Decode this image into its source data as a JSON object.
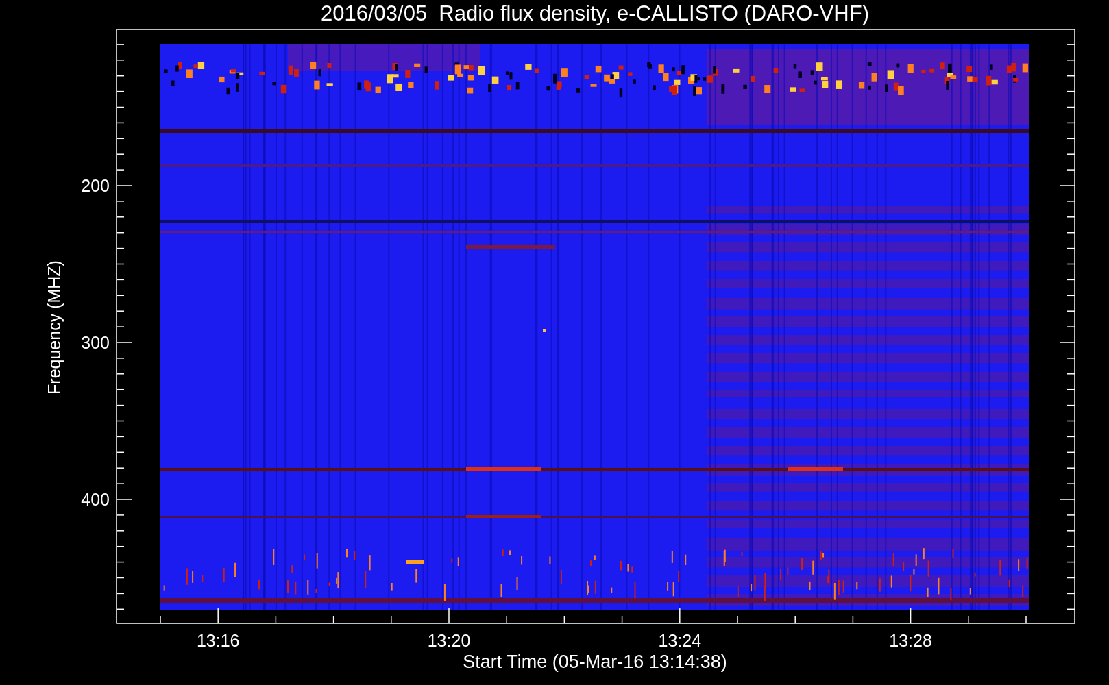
{
  "title": "2016/03/05  Radio flux density, e-CALLISTO (DARO-VHF)",
  "y_axis": {
    "label": "Frequency (MHZ)",
    "ticks": [
      "200",
      "300",
      "400"
    ]
  },
  "x_axis": {
    "label": "Start Time (05-Mar-16 13:14:38)",
    "ticks": [
      "13:16",
      "13:20",
      "13:24",
      "13:28"
    ]
  }
}
